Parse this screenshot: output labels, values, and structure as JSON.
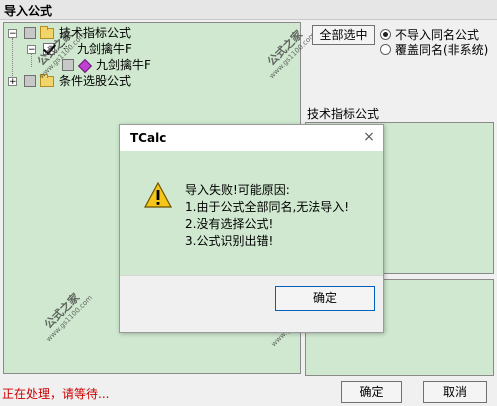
{
  "window": {
    "title": "导入公式"
  },
  "tree": {
    "items": [
      {
        "label": "技术指标公式",
        "expander": "−"
      },
      {
        "label": "九剑擒牛F",
        "expander": "−"
      },
      {
        "label": "九剑擒牛F"
      },
      {
        "label": "条件选股公式",
        "expander": "+"
      }
    ]
  },
  "options": {
    "select_all_label": "全部选中",
    "radio_skip_label": "不导入同名公式",
    "radio_overwrite_label": "覆盖同名(非系统)",
    "selected": "skip"
  },
  "right": {
    "category_label": "技术指标公式"
  },
  "watermark": {
    "text": "公式之家",
    "url": "www.gs1100.com"
  },
  "dialog": {
    "title": "TCalc",
    "close_glyph": "×",
    "lines": [
      "导入失败!可能原因:",
      "1.由于公式全部同名,无法导入!",
      "2.没有选择公式!",
      "3.公式识别出错!"
    ],
    "ok_label": "确定"
  },
  "status": {
    "text": "正在处理，请等待..."
  },
  "footer": {
    "ok_label": "确定",
    "cancel_label": "取消"
  },
  "colors": {
    "panel_bg": "#cfe8cf",
    "status": "#cc0000",
    "accent_gem": "#c040d0"
  }
}
